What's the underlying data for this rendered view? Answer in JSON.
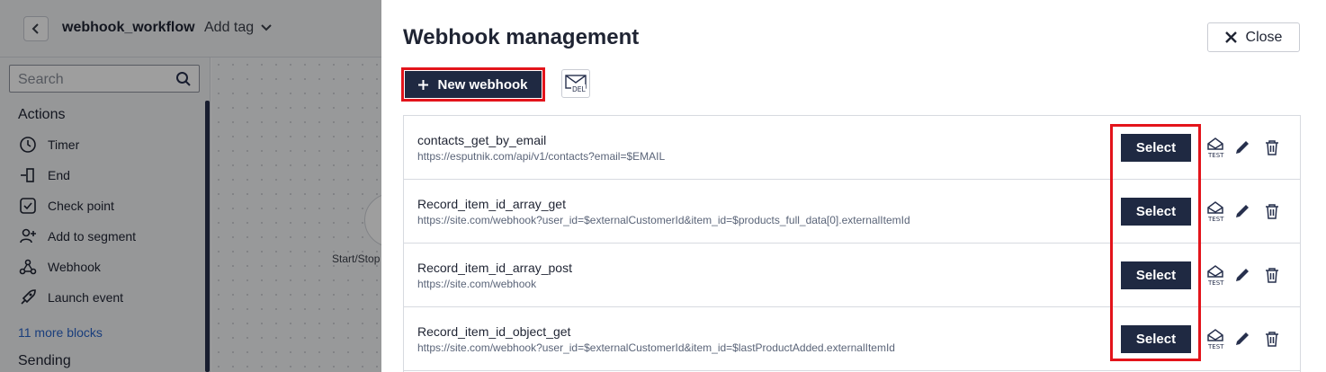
{
  "topbar": {
    "title": "webhook_workflow",
    "add_tag_label": "Add tag"
  },
  "sidebar": {
    "search_placeholder": "Search",
    "actions_heading": "Actions",
    "items": [
      {
        "label": "Timer",
        "icon": "timer-icon"
      },
      {
        "label": "End",
        "icon": "end-icon"
      },
      {
        "label": "Check point",
        "icon": "check-point-icon"
      },
      {
        "label": "Add to segment",
        "icon": "add-to-segment-icon"
      },
      {
        "label": "Webhook",
        "icon": "webhook-icon"
      },
      {
        "label": "Launch event",
        "icon": "launch-event-icon"
      }
    ],
    "more_link": "11 more blocks",
    "sending_heading": "Sending"
  },
  "canvas": {
    "start_label": "Start/Stop"
  },
  "modal": {
    "title": "Webhook management",
    "close_label": "Close",
    "new_webhook_label": "New webhook",
    "select_label": "Select",
    "webhooks": [
      {
        "name": "contacts_get_by_email",
        "url": "https://esputnik.com/api/v1/contacts?email=$EMAIL"
      },
      {
        "name": "Record_item_id_array_get",
        "url": "https://site.com/webhook?user_id=$externalCustomerId&item_id=$products_full_data[0].externalItemId"
      },
      {
        "name": "Record_item_id_array_post",
        "url": "https://site.com/webhook"
      },
      {
        "name": "Record_item_id_object_get",
        "url": "https://site.com/webhook?user_id=$externalCustomerId&item_id=$lastProductAdded.externalItemId"
      }
    ]
  },
  "colors": {
    "primary_button": "#1f2942",
    "highlight": "#e3141b",
    "link": "#2a64c9"
  }
}
